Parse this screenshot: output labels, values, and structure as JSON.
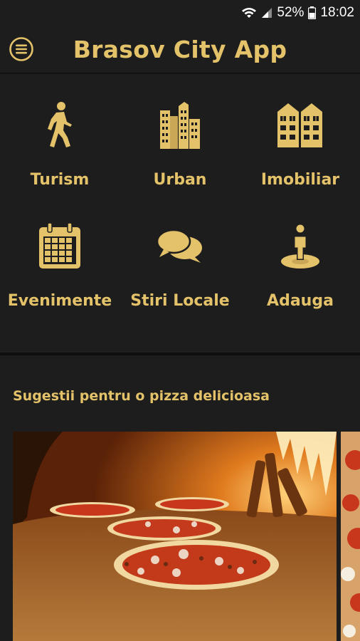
{
  "status": {
    "battery": "52%",
    "time": "18:02"
  },
  "header": {
    "title": "Brasov City App",
    "menu_icon": "menu-icon"
  },
  "categories": [
    {
      "label": "Turism",
      "icon": "walking-person-icon"
    },
    {
      "label": "Urban",
      "icon": "city-buildings-icon"
    },
    {
      "label": "Imobiliar",
      "icon": "apartment-buildings-icon"
    },
    {
      "label": "Evenimente",
      "icon": "calendar-icon"
    },
    {
      "label": "Stiri Locale",
      "icon": "chat-bubbles-icon"
    },
    {
      "label": "Adauga",
      "icon": "person-location-icon"
    }
  ],
  "suggestions": {
    "title": "Sugestii pentru o pizza delicioasa"
  },
  "colors": {
    "accent": "#e4c26a",
    "background": "#1d1d1d"
  }
}
